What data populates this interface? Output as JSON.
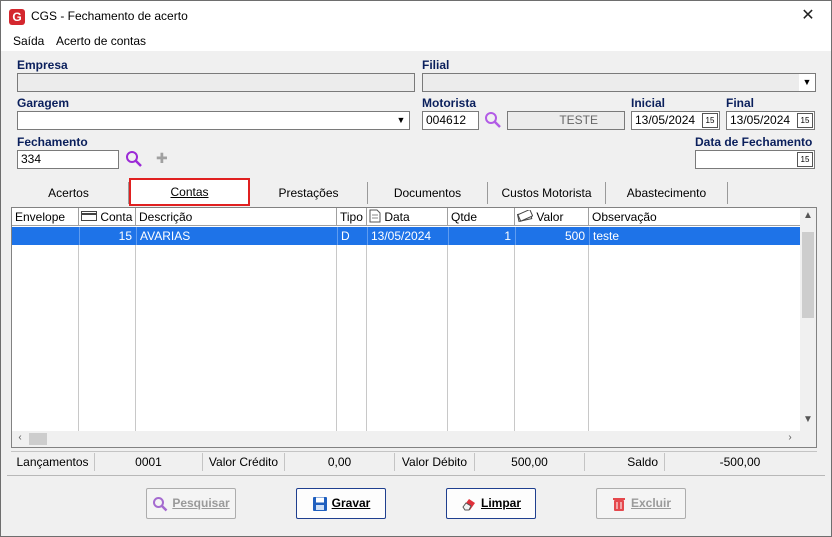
{
  "window": {
    "title": "CGS - Fechamento de acerto"
  },
  "menu": [
    {
      "label": "Saída"
    },
    {
      "label": "Acerto de contas"
    }
  ],
  "form": {
    "empresa": {
      "label": "Empresa",
      "value": ""
    },
    "filial": {
      "label": "Filial",
      "value": ""
    },
    "garagem": {
      "label": "Garagem",
      "value": ""
    },
    "motorista": {
      "label": "Motorista",
      "code": "004612",
      "name": "TESTE"
    },
    "inicial": {
      "label": "Inicial",
      "value": "13/05/2024"
    },
    "final": {
      "label": "Final",
      "value": "13/05/2024"
    },
    "fechamento": {
      "label": "Fechamento",
      "value": "334"
    },
    "data_fechamento": {
      "label": "Data de Fechamento",
      "value": " / /"
    }
  },
  "tabs": [
    {
      "label": "Acertos"
    },
    {
      "label": "Contas",
      "active": true
    },
    {
      "label": "Prestações"
    },
    {
      "label": "Documentos"
    },
    {
      "label": "Custos Motorista"
    },
    {
      "label": "Abastecimento"
    }
  ],
  "grid": {
    "columns": [
      "Envelope",
      "Conta",
      "Descrição",
      "Tipo",
      "Data",
      "Qtde",
      "Valor",
      "Observação"
    ],
    "rows": [
      {
        "envelope": "",
        "conta": "15",
        "descricao": "AVARIAS",
        "tipo": "D",
        "data": "13/05/2024",
        "qtde": "1",
        "valor": "500",
        "observacao": "teste",
        "selected": true
      }
    ]
  },
  "summary": {
    "lancamentos_label": "Lançamentos",
    "lancamentos_value": "0001",
    "credito_label": "Valor Crédito",
    "credito_value": "0,00",
    "debito_label": "Valor Débito",
    "debito_value": "500,00",
    "saldo_label": "Saldo",
    "saldo_value": "-500,00"
  },
  "buttons": {
    "pesquisar": "Pesquisar",
    "gravar": "Gravar",
    "limpar": "Limpar",
    "excluir": "Excluir"
  },
  "colors": {
    "selection": "#1e73e8",
    "label_blue": "#0a1f5c",
    "tab_highlight": "#e02020"
  }
}
